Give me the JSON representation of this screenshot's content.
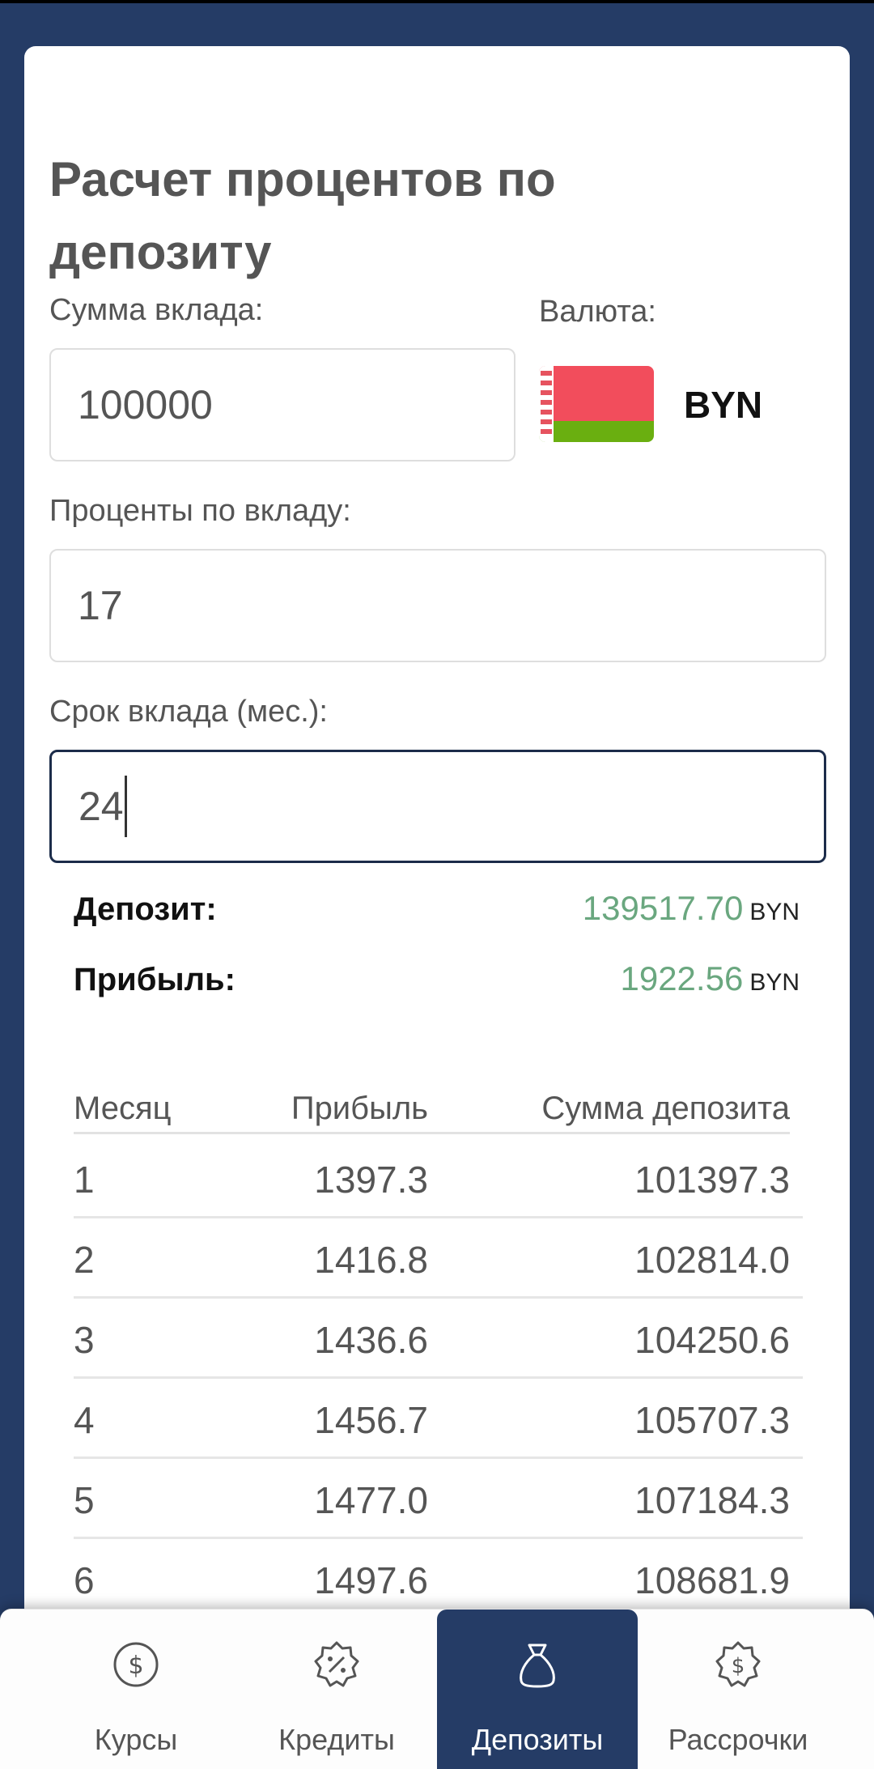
{
  "page": {
    "title": "Расчет процентов по депозиту"
  },
  "form": {
    "amount_label": "Сумма вклада:",
    "amount_value": "100000",
    "currency_label": "Валюта:",
    "currency_code": "BYN",
    "rate_label": "Проценты по вкладу:",
    "rate_value": "17",
    "term_label": "Срок вклада (мес.):",
    "term_value": "24"
  },
  "summary": {
    "deposit_label": "Депозит:",
    "deposit_value": "139517.70",
    "deposit_currency": "BYN",
    "profit_label": "Прибыль:",
    "profit_value": "1922.56",
    "profit_currency": "BYN"
  },
  "table": {
    "headers": [
      "Месяц",
      "Прибыль",
      "Сумма депозита"
    ],
    "rows": [
      [
        "1",
        "1397.3",
        "101397.3"
      ],
      [
        "2",
        "1416.8",
        "102814.0"
      ],
      [
        "3",
        "1436.6",
        "104250.6"
      ],
      [
        "4",
        "1456.7",
        "105707.3"
      ],
      [
        "5",
        "1477.0",
        "107184.3"
      ],
      [
        "6",
        "1497.6",
        "108681.9"
      ]
    ]
  },
  "nav": {
    "items": [
      {
        "label": "Курсы",
        "icon": "dollar-circle-icon"
      },
      {
        "label": "Кредиты",
        "icon": "percent-badge-icon"
      },
      {
        "label": "Депозиты",
        "icon": "money-bag-icon"
      },
      {
        "label": "Рассрочки",
        "icon": "dollar-badge-icon"
      }
    ],
    "active_index": 2
  },
  "colors": {
    "navy": "#253c66",
    "positive": "#6aa77f",
    "text": "#555555"
  }
}
